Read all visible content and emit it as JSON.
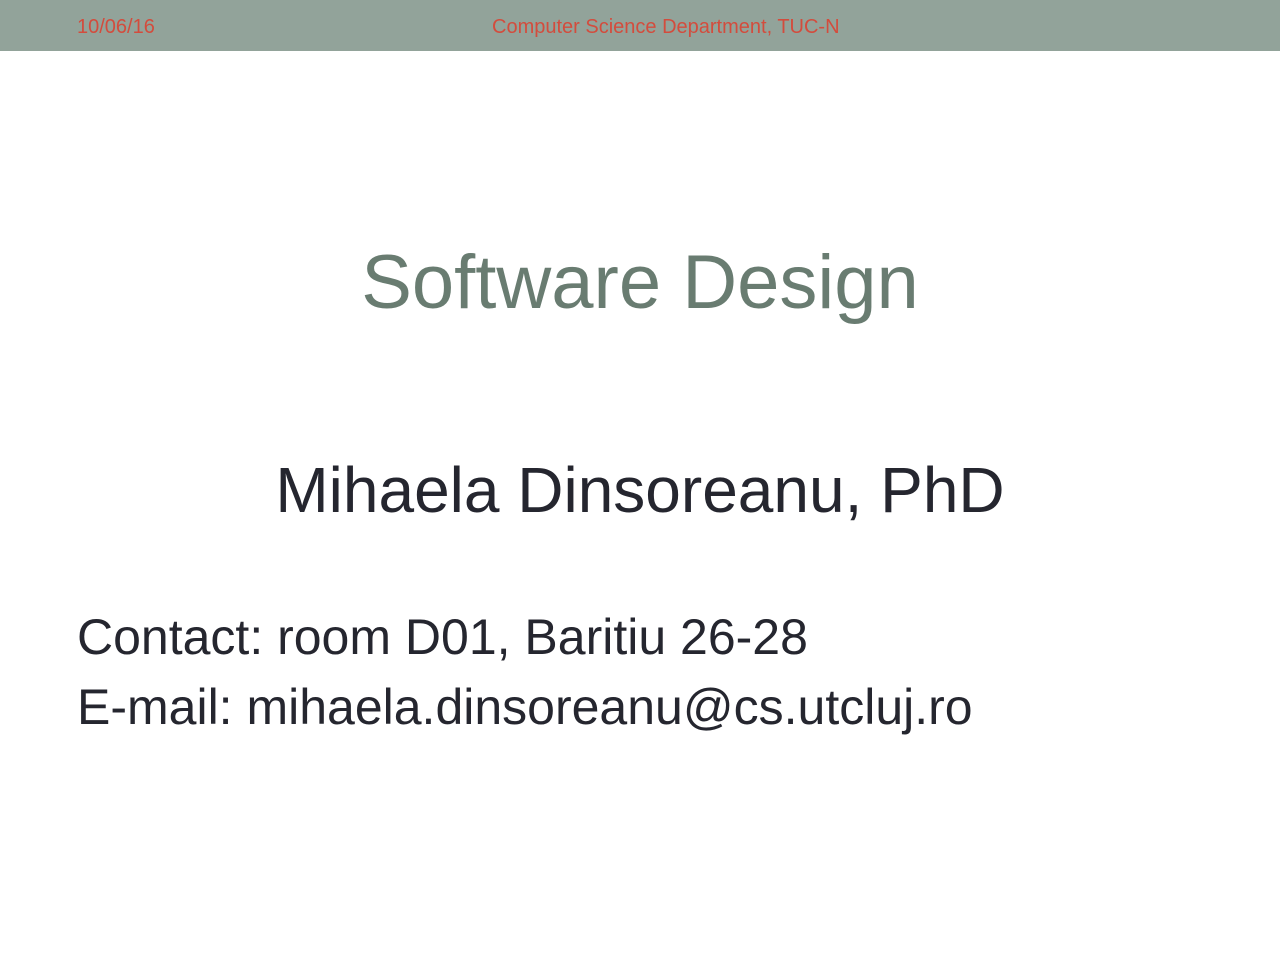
{
  "header": {
    "date": "10/06/16",
    "department": "Computer Science Department, TUC-N"
  },
  "slide": {
    "title": "Software Design",
    "author": "Mihaela Dinsoreanu, PhD",
    "contact": "Contact: room D01, Baritiu 26-28",
    "email": "E-mail: mihaela.dinsoreanu@cs.utcluj.ro"
  },
  "colors": {
    "header_bar": "#92a39a",
    "header_text": "#d34c3d",
    "title_text": "#697c71",
    "body_text": "#25262f"
  }
}
